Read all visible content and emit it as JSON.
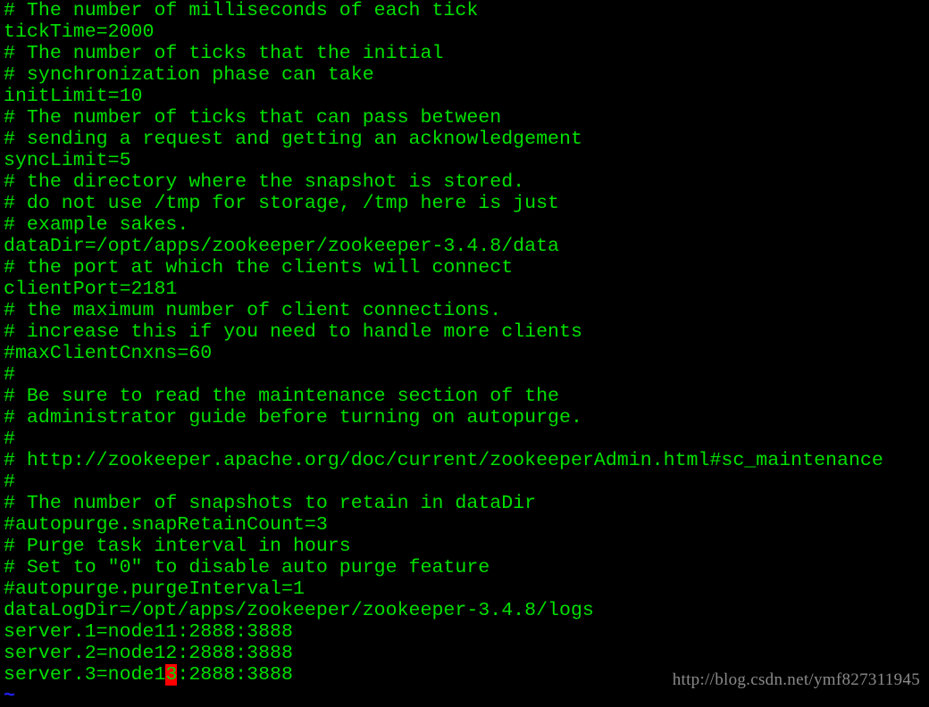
{
  "terminal": {
    "lines": [
      "# The number of milliseconds of each tick",
      "tickTime=2000",
      "# The number of ticks that the initial",
      "# synchronization phase can take",
      "initLimit=10",
      "# The number of ticks that can pass between",
      "# sending a request and getting an acknowledgement",
      "syncLimit=5",
      "# the directory where the snapshot is stored.",
      "# do not use /tmp for storage, /tmp here is just",
      "# example sakes.",
      "dataDir=/opt/apps/zookeeper/zookeeper-3.4.8/data",
      "# the port at which the clients will connect",
      "clientPort=2181",
      "# the maximum number of client connections.",
      "# increase this if you need to handle more clients",
      "#maxClientCnxns=60",
      "#",
      "# Be sure to read the maintenance section of the",
      "# administrator guide before turning on autopurge.",
      "#",
      "# http://zookeeper.apache.org/doc/current/zookeeperAdmin.html#sc_maintenance",
      "#",
      "# The number of snapshots to retain in dataDir",
      "#autopurge.snapRetainCount=3",
      "# Purge task interval in hours",
      "# Set to \"0\" to disable auto purge feature",
      "#autopurge.purgeInterval=1",
      "dataLogDir=/opt/apps/zookeeper/zookeeper-3.4.8/logs",
      "server.1=node11:2888:3888",
      "server.2=node12:2888:3888"
    ],
    "cursor_line": {
      "before": "server.3=node1",
      "cursor_char": "3",
      "after": ":2888:3888"
    },
    "empty_line_marker": "~"
  },
  "watermark": "http://blog.csdn.net/ymf827311945",
  "colors": {
    "text": "#00e000",
    "background": "#000000",
    "cursor": "#ff0000",
    "tilde": "#2020ff"
  }
}
